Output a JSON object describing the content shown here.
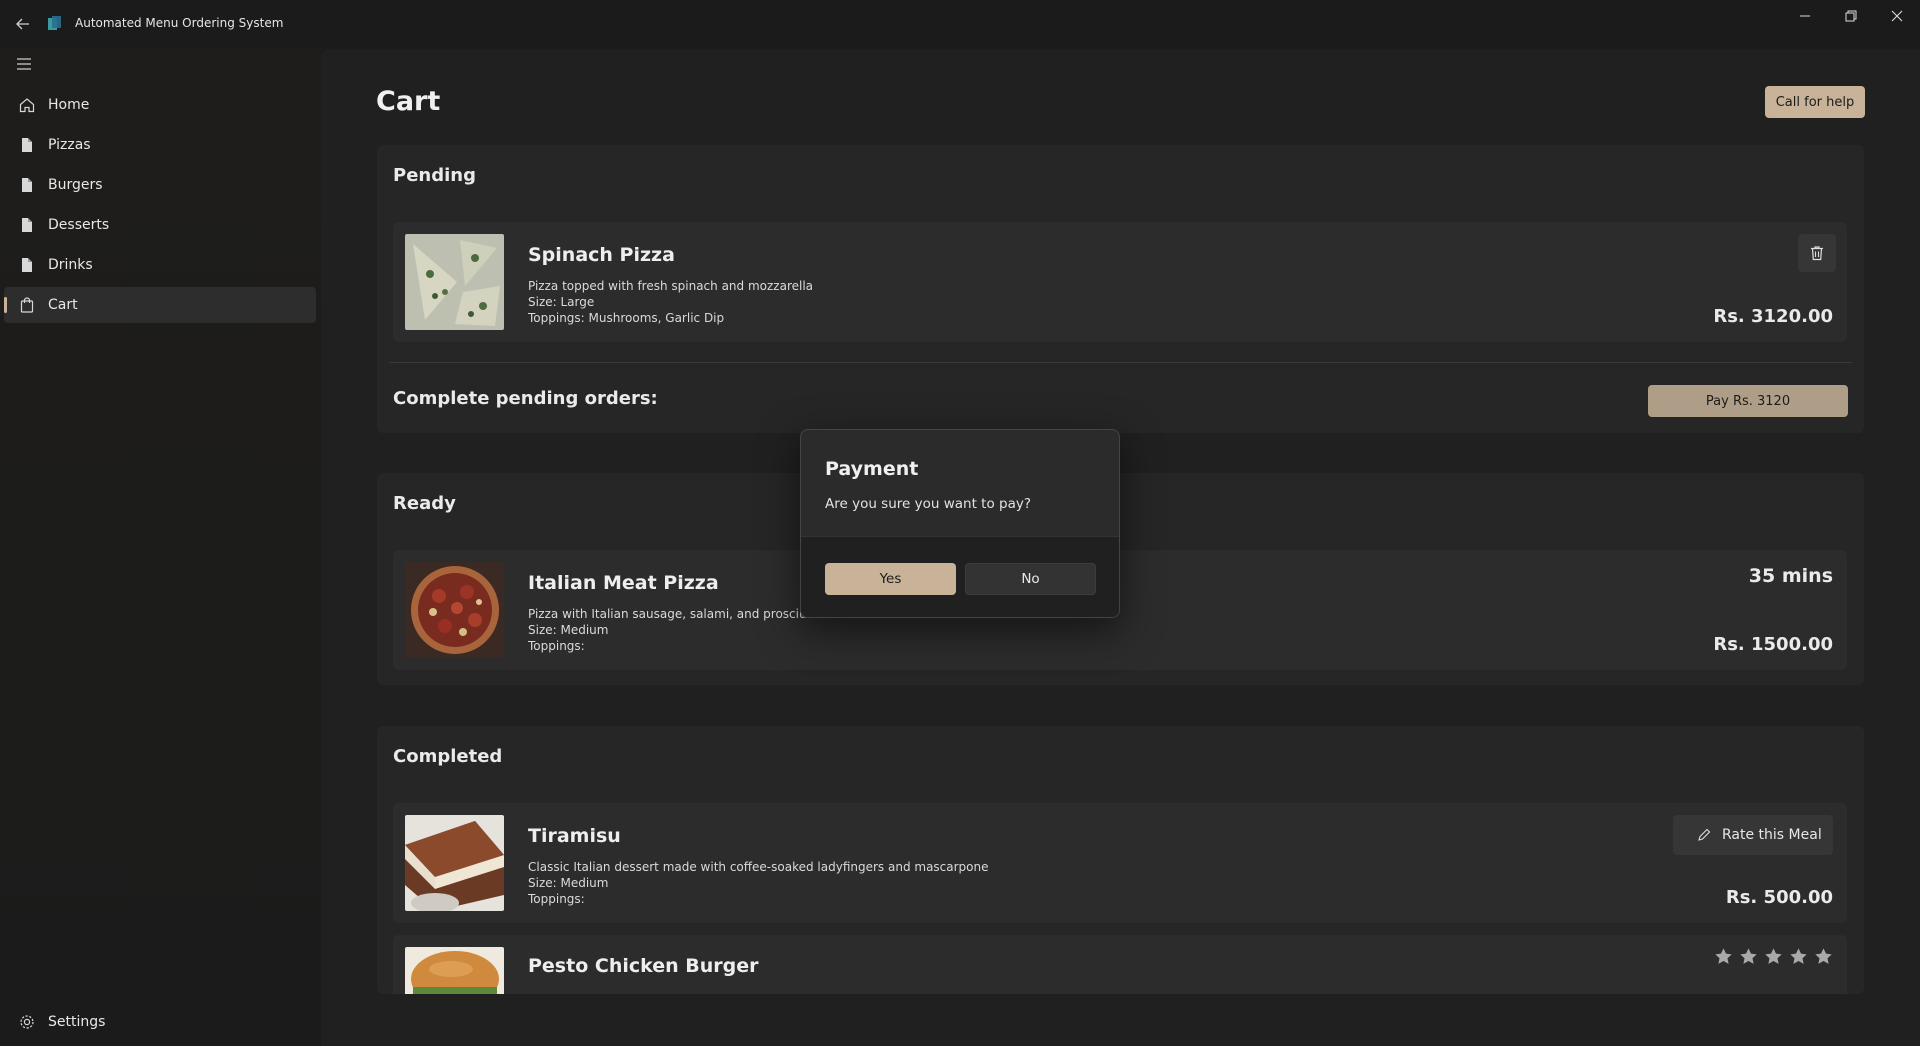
{
  "window": {
    "title": "Automated Menu Ordering System"
  },
  "sidebar": {
    "items": [
      {
        "label": "Home",
        "icon": "home-icon"
      },
      {
        "label": "Pizzas",
        "icon": "document-icon"
      },
      {
        "label": "Burgers",
        "icon": "document-icon"
      },
      {
        "label": "Desserts",
        "icon": "document-icon"
      },
      {
        "label": "Drinks",
        "icon": "document-icon"
      },
      {
        "label": "Cart",
        "icon": "shopping-bag-icon",
        "active": true
      }
    ],
    "settings_label": "Settings"
  },
  "header": {
    "title": "Cart",
    "help_label": "Call for help"
  },
  "pending": {
    "title": "Pending",
    "items": [
      {
        "name": "Spinach Pizza",
        "description": "Pizza topped with fresh spinach and mozzarella",
        "size": "Size: Large",
        "toppings": "Toppings: Mushrooms, Garlic Dip",
        "price": "Rs. 3120.00"
      }
    ],
    "complete_label": "Complete pending orders:",
    "pay_label": "Pay Rs. 3120"
  },
  "ready": {
    "title": "Ready",
    "items": [
      {
        "name": "Italian Meat Pizza",
        "description": "Pizza with Italian sausage, salami, and prosciutto",
        "size": "Size: Medium",
        "toppings": "Toppings:",
        "time": "35 mins",
        "price": "Rs. 1500.00"
      }
    ]
  },
  "completed": {
    "title": "Completed",
    "items": [
      {
        "name": "Tiramisu",
        "description": "Classic Italian dessert made with coffee-soaked ladyfingers and mascarpone",
        "size": "Size: Medium",
        "toppings": "Toppings:",
        "price": "Rs. 500.00",
        "rate_label": "Rate this Meal"
      },
      {
        "name": "Pesto Chicken Burger",
        "rating_stars": 5
      }
    ]
  },
  "dialog": {
    "title": "Payment",
    "message": "Are you sure you want to pay?",
    "yes_label": "Yes",
    "no_label": "No"
  },
  "colors": {
    "accent": "#c8b398",
    "background": "#202020",
    "card": "#2c2c2c"
  }
}
